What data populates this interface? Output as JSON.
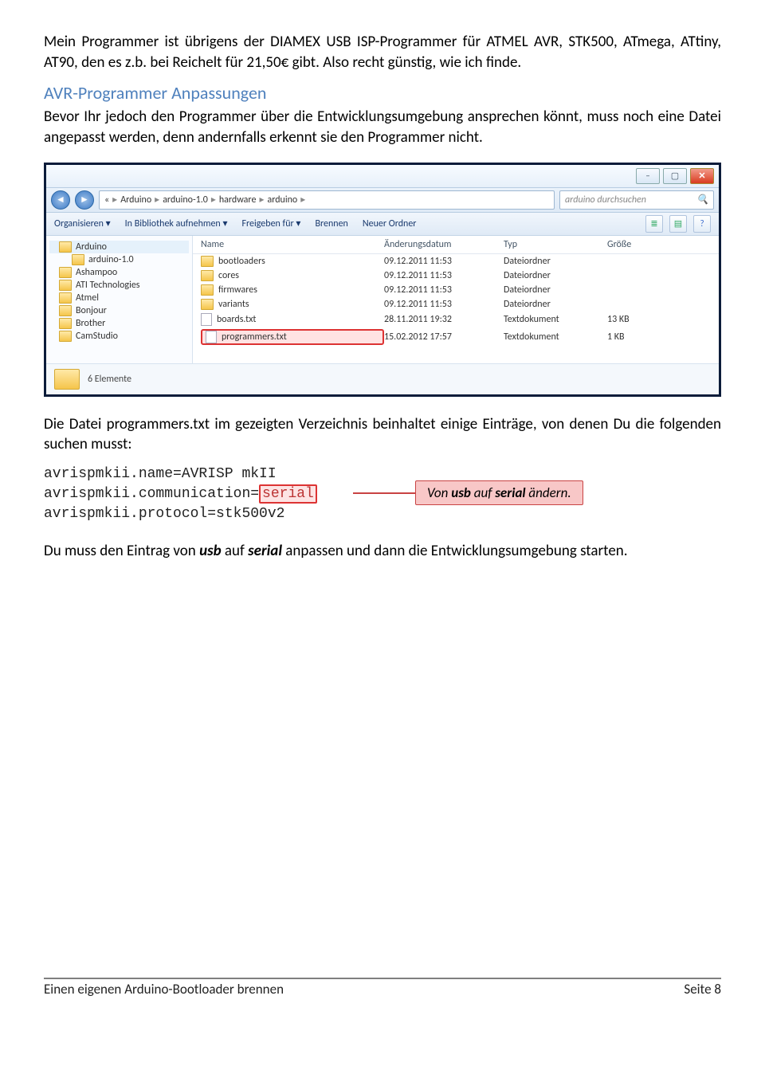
{
  "para1": "Mein Programmer ist übrigens der DIAMEX USB ISP-Programmer für ATMEL AVR, STK500, ATmega, ATtiny, AT90, den es z.b. bei Reichelt für 21,50€ gibt. Also recht günstig, wie ich finde.",
  "heading": "AVR-Programmer Anpassungen",
  "para2": "Bevor Ihr jedoch den Programmer über die Entwicklungsumgebung ansprechen könnt, muss noch eine Datei angepasst werden, denn andernfalls erkennt sie den Programmer nicht.",
  "explorer": {
    "breadcrumbs": [
      "«",
      "Arduino",
      "arduino-1.0",
      "hardware",
      "arduino"
    ],
    "search_placeholder": "arduino durchsuchen",
    "toolbar": {
      "organize": "Organisieren ▾",
      "library": "In Bibliothek aufnehmen ▾",
      "share": "Freigeben für ▾",
      "burn": "Brennen",
      "newfolder": "Neuer Ordner"
    },
    "tree": [
      "Arduino",
      "arduino-1.0",
      "Ashampoo",
      "ATI Technologies",
      "Atmel",
      "Bonjour",
      "Brother",
      "CamStudio"
    ],
    "columns": {
      "name": "Name",
      "date": "Änderungsdatum",
      "type": "Typ",
      "size": "Größe"
    },
    "rows": [
      {
        "name": "bootloaders",
        "date": "09.12.2011 11:53",
        "type": "Dateiordner",
        "size": "",
        "kind": "folder"
      },
      {
        "name": "cores",
        "date": "09.12.2011 11:53",
        "type": "Dateiordner",
        "size": "",
        "kind": "folder"
      },
      {
        "name": "firmwares",
        "date": "09.12.2011 11:53",
        "type": "Dateiordner",
        "size": "",
        "kind": "folder"
      },
      {
        "name": "variants",
        "date": "09.12.2011 11:53",
        "type": "Dateiordner",
        "size": "",
        "kind": "folder"
      },
      {
        "name": "boards.txt",
        "date": "28.11.2011 19:32",
        "type": "Textdokument",
        "size": "13 KB",
        "kind": "file"
      },
      {
        "name": "programmers.txt",
        "date": "15.02.2012 17:57",
        "type": "Textdokument",
        "size": "1 KB",
        "kind": "file",
        "highlight": true
      }
    ],
    "status": "6 Elemente"
  },
  "para3": "Die Datei programmers.txt im gezeigten Verzeichnis beinhaltet einige Einträge, von denen Du die folgenden suchen musst:",
  "code": {
    "line1a": "avrispmkii.name=AVRISP mkII",
    "line2a": "avrispmkii.communication=",
    "line2b": "serial",
    "line3a": "avrispmkii.protocol=stk500v2"
  },
  "callout_pre": "Von ",
  "callout_b1": "usb",
  "callout_mid": " auf ",
  "callout_b2": "serial",
  "callout_post": " ändern.",
  "para4_pre": "Du muss den Eintrag von ",
  "para4_b1": "usb",
  "para4_mid": " auf ",
  "para4_b2": "serial",
  "para4_post": " anpassen und dann die Entwicklungsumgebung starten.",
  "footer_left": "Einen eigenen Arduino-Bootloader brennen",
  "footer_right": "Seite 8"
}
